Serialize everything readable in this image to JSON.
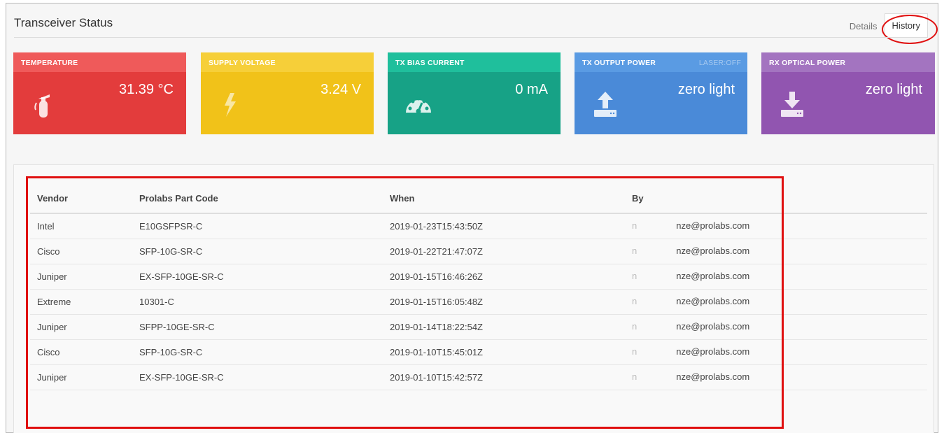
{
  "header": {
    "title": "Transceiver Status",
    "tabs": [
      {
        "label": "Details",
        "active": false
      },
      {
        "label": "History",
        "active": true
      }
    ]
  },
  "cards": [
    {
      "id": "temperature",
      "label": "TEMPERATURE",
      "value": "31.39 °C",
      "icon": "fire-extinguisher-icon",
      "color": "#e33c3c"
    },
    {
      "id": "supply_voltage",
      "label": "SUPPLY VOLTAGE",
      "value": "3.24 V",
      "icon": "lightning-bolt-icon",
      "color": "#f1c219"
    },
    {
      "id": "tx_bias_current",
      "label": "TX BIAS CURRENT",
      "value": "0 mA",
      "icon": "gauge-icon",
      "color": "#17a286"
    },
    {
      "id": "tx_output_power",
      "label": "TX OUTPUT POWER",
      "status": "LASER:OFF",
      "value": "zero light",
      "icon": "upload-icon",
      "color": "#4a8ad8"
    },
    {
      "id": "rx_optical_power",
      "label": "RX OPTICAL POWER",
      "value": "zero light",
      "icon": "download-icon",
      "color": "#9155b0"
    }
  ],
  "history": {
    "columns": [
      "Vendor",
      "Prolabs Part Code",
      "When",
      "By"
    ],
    "rows": [
      {
        "vendor": "Intel",
        "part": "E10GSFPSR-C",
        "when": "2019-01-23T15:43:50Z",
        "by_prefix": "n",
        "by_suffix": "nze@prolabs.com"
      },
      {
        "vendor": "Cisco",
        "part": "SFP-10G-SR-C",
        "when": "2019-01-22T21:47:07Z",
        "by_prefix": "n",
        "by_suffix": "nze@prolabs.com"
      },
      {
        "vendor": "Juniper",
        "part": "EX-SFP-10GE-SR-C",
        "when": "2019-01-15T16:46:26Z",
        "by_prefix": "n",
        "by_suffix": "nze@prolabs.com"
      },
      {
        "vendor": "Extreme",
        "part": "10301-C",
        "when": "2019-01-15T16:05:48Z",
        "by_prefix": "n",
        "by_suffix": "nze@prolabs.com"
      },
      {
        "vendor": "Juniper",
        "part": "SFPP-10GE-SR-C",
        "when": "2019-01-14T18:22:54Z",
        "by_prefix": "n",
        "by_suffix": "nze@prolabs.com"
      },
      {
        "vendor": "Cisco",
        "part": "SFP-10G-SR-C",
        "when": "2019-01-10T15:45:01Z",
        "by_prefix": "n",
        "by_suffix": "nze@prolabs.com"
      },
      {
        "vendor": "Juniper",
        "part": "EX-SFP-10GE-SR-C",
        "when": "2019-01-10T15:42:57Z",
        "by_prefix": "n",
        "by_suffix": "nze@prolabs.com"
      }
    ]
  },
  "annotations": {
    "highlight_color": "#e01010"
  }
}
